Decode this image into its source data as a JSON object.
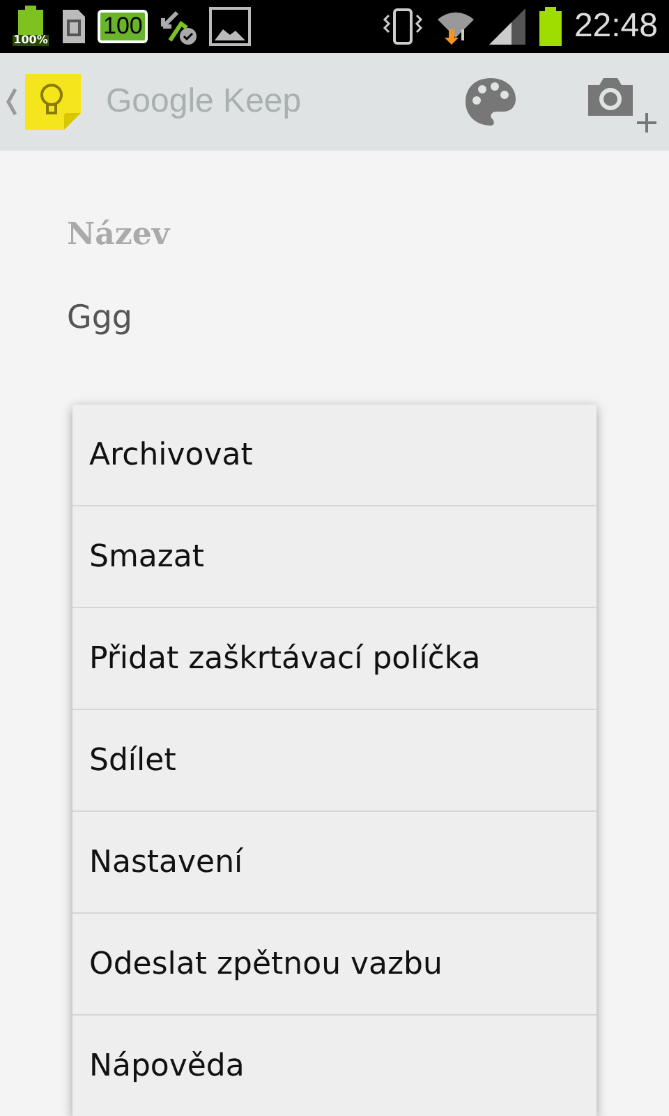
{
  "status_bar": {
    "battery_label": "100%",
    "notification_count": "100",
    "time": "22:48"
  },
  "app_bar": {
    "title": "Google Keep"
  },
  "note": {
    "title": {
      "placeholder": "Název"
    },
    "body": {
      "value": "Ggg"
    }
  },
  "menu": {
    "items": [
      {
        "label": "Archivovat"
      },
      {
        "label": "Smazat"
      },
      {
        "label": "Přidat zaškrtávací políčka"
      },
      {
        "label": "Sdílet"
      },
      {
        "label": "Nastavení"
      },
      {
        "label": "Odeslat zpětnou vazbu"
      },
      {
        "label": "Nápověda"
      }
    ]
  }
}
